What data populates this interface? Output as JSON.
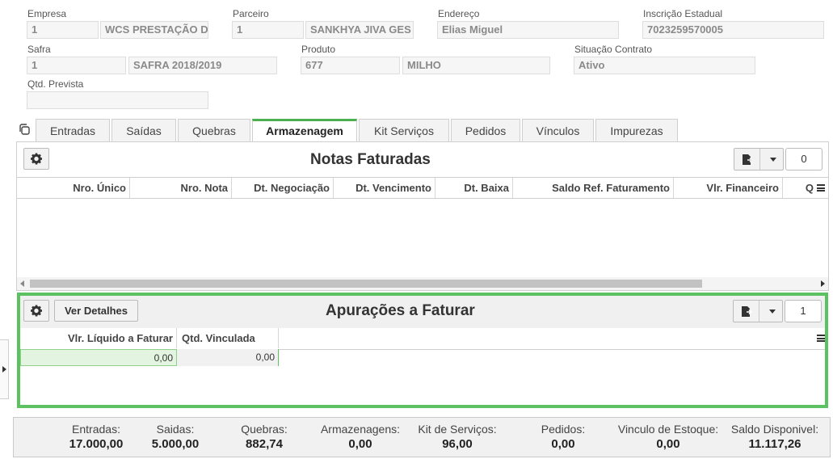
{
  "header": {
    "empresa_label": "Empresa",
    "empresa_code": "1",
    "empresa_name": "WCS PRESTAÇÃO D",
    "parceiro_label": "Parceiro",
    "parceiro_code": "1",
    "parceiro_name": "SANKHYA JIVA GES",
    "endereco_label": "Endereço",
    "endereco_value": "Elias Miguel",
    "inscricao_label": "Inscrição Estadual",
    "inscricao_value": "7023259570005",
    "safra_label": "Safra",
    "safra_code": "1",
    "safra_name": "SAFRA 2018/2019",
    "produto_label": "Produto",
    "produto_code": "677",
    "produto_name": "MILHO",
    "situacao_label": "Situação Contrato",
    "situacao_value": "Ativo",
    "qtd_prevista_label": "Qtd. Prevista",
    "qtd_prevista_value": ""
  },
  "tabs": [
    "Entradas",
    "Saídas",
    "Quebras",
    "Armazenagem",
    "Kit Serviços",
    "Pedidos",
    "Vínculos",
    "Impurezas"
  ],
  "active_tab": "Armazenagem",
  "notas": {
    "title": "Notas Faturadas",
    "count": "0",
    "columns": [
      "Nro. Único",
      "Nro. Nota",
      "Dt. Negociação",
      "Dt. Vencimento",
      "Dt. Baixa",
      "Saldo Ref. Faturamento",
      "Vlr. Financeiro",
      "Q"
    ]
  },
  "apuracoes": {
    "title": "Apurações a Faturar",
    "details_button": "Ver Detalhes",
    "count": "1",
    "columns": [
      "Vlr. Líquido a Faturar",
      "Qtd. Vinculada"
    ],
    "rows": [
      [
        "0,00",
        "0,00"
      ]
    ]
  },
  "summary": [
    {
      "label": "Entradas:",
      "value": "17.000,00"
    },
    {
      "label": "Saidas:",
      "value": "5.000,00"
    },
    {
      "label": "Quebras:",
      "value": "882,74"
    },
    {
      "label": "Armazenagens:",
      "value": "0,00"
    },
    {
      "label": "Kit de Serviços:",
      "value": "96,00"
    },
    {
      "label": "Pedidos:",
      "value": "0,00"
    },
    {
      "label": "Vinculo de Estoque:",
      "value": "0,00"
    },
    {
      "label": "Saldo Disponivel:",
      "value": "11.117,26"
    }
  ],
  "colors": {
    "accent": "#5cc160",
    "selected_cell": "#e3f4e0"
  },
  "icons": [
    "gear-icon",
    "export-icon",
    "chevron-down-icon",
    "column-menu-icon",
    "copy-icon",
    "expand-arrow-icon"
  ]
}
